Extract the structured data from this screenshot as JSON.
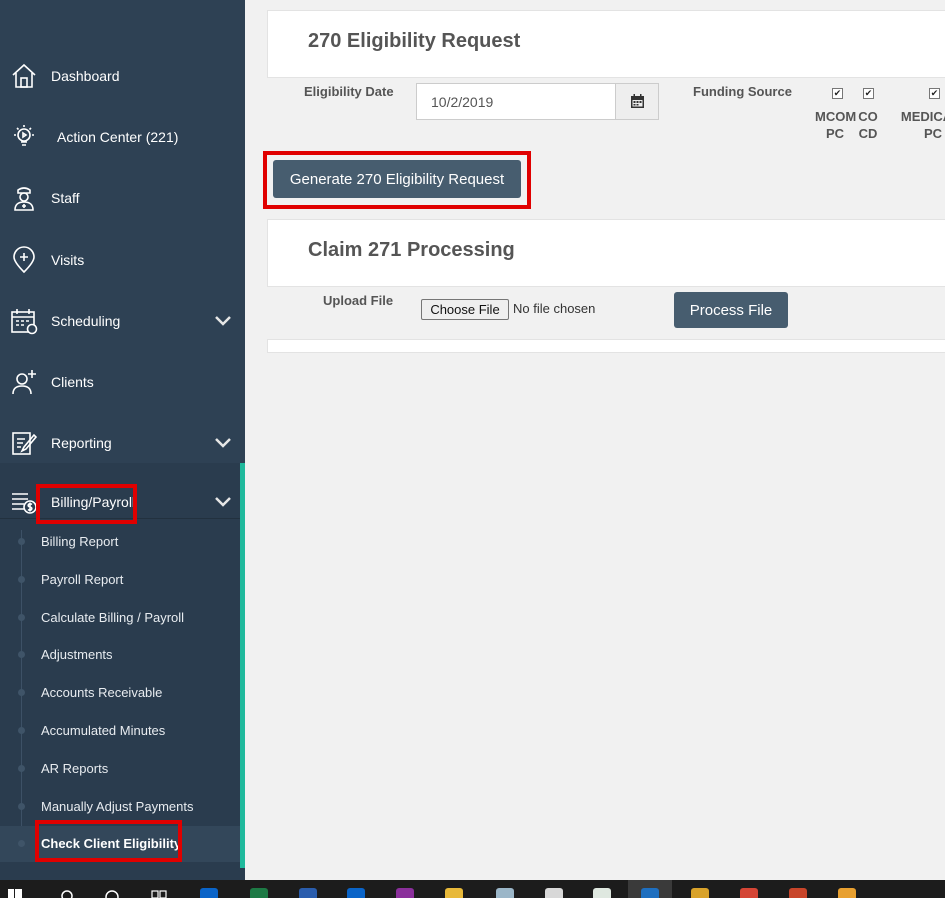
{
  "sidebar": {
    "items": [
      {
        "name": "dashboard",
        "label": "Dashboard",
        "icon": "home-icon",
        "has_chevron": false
      },
      {
        "name": "action-center",
        "label": "Action Center (221)",
        "icon": "lightbulb-icon",
        "has_chevron": false
      },
      {
        "name": "staff",
        "label": "Staff",
        "icon": "nurse-icon",
        "has_chevron": false
      },
      {
        "name": "visits",
        "label": "Visits",
        "icon": "location-pin-icon",
        "has_chevron": false
      },
      {
        "name": "scheduling",
        "label": "Scheduling",
        "icon": "calendar-icon",
        "has_chevron": true
      },
      {
        "name": "clients",
        "label": "Clients",
        "icon": "client-add-icon",
        "has_chevron": false
      },
      {
        "name": "reporting",
        "label": "Reporting",
        "icon": "report-edit-icon",
        "has_chevron": true
      },
      {
        "name": "billing-payroll",
        "label": "Billing/Payroll",
        "icon": "billing-dollar-icon",
        "has_chevron": true
      }
    ],
    "billing_submenu": [
      {
        "label": "Billing Report",
        "active": false
      },
      {
        "label": "Payroll Report",
        "active": false
      },
      {
        "label": "Calculate Billing / Payroll",
        "active": false
      },
      {
        "label": "Adjustments",
        "active": false
      },
      {
        "label": "Accounts Receivable",
        "active": false
      },
      {
        "label": "Accumulated Minutes",
        "active": false
      },
      {
        "label": "AR Reports",
        "active": false
      },
      {
        "label": "Manually Adjust Payments",
        "active": false
      },
      {
        "label": "Check Client Eligibility",
        "active": true
      }
    ]
  },
  "eligibility": {
    "title": "270 Eligibility Request",
    "date_label": "Eligibility Date",
    "date_value": "10/2/2019",
    "funding_label": "Funding Source",
    "funding_sources": [
      {
        "line1": "MCOM",
        "line2": "PC",
        "checked": true
      },
      {
        "line1": "CO",
        "line2": "CD",
        "checked": true
      },
      {
        "line1": "MEDICAID",
        "line2": "PC",
        "checked": true
      }
    ],
    "generate_button": "Generate 270 Eligibility Request"
  },
  "claim": {
    "title": "Claim 271 Processing",
    "upload_label": "Upload File",
    "choose_file": "Choose File",
    "no_file": "No file chosen",
    "process_button": "Process File"
  },
  "colors": {
    "sidebar_bg": "#2e4154",
    "accent": "#1fb99c",
    "highlight": "#e00000",
    "button": "#475d6f"
  }
}
